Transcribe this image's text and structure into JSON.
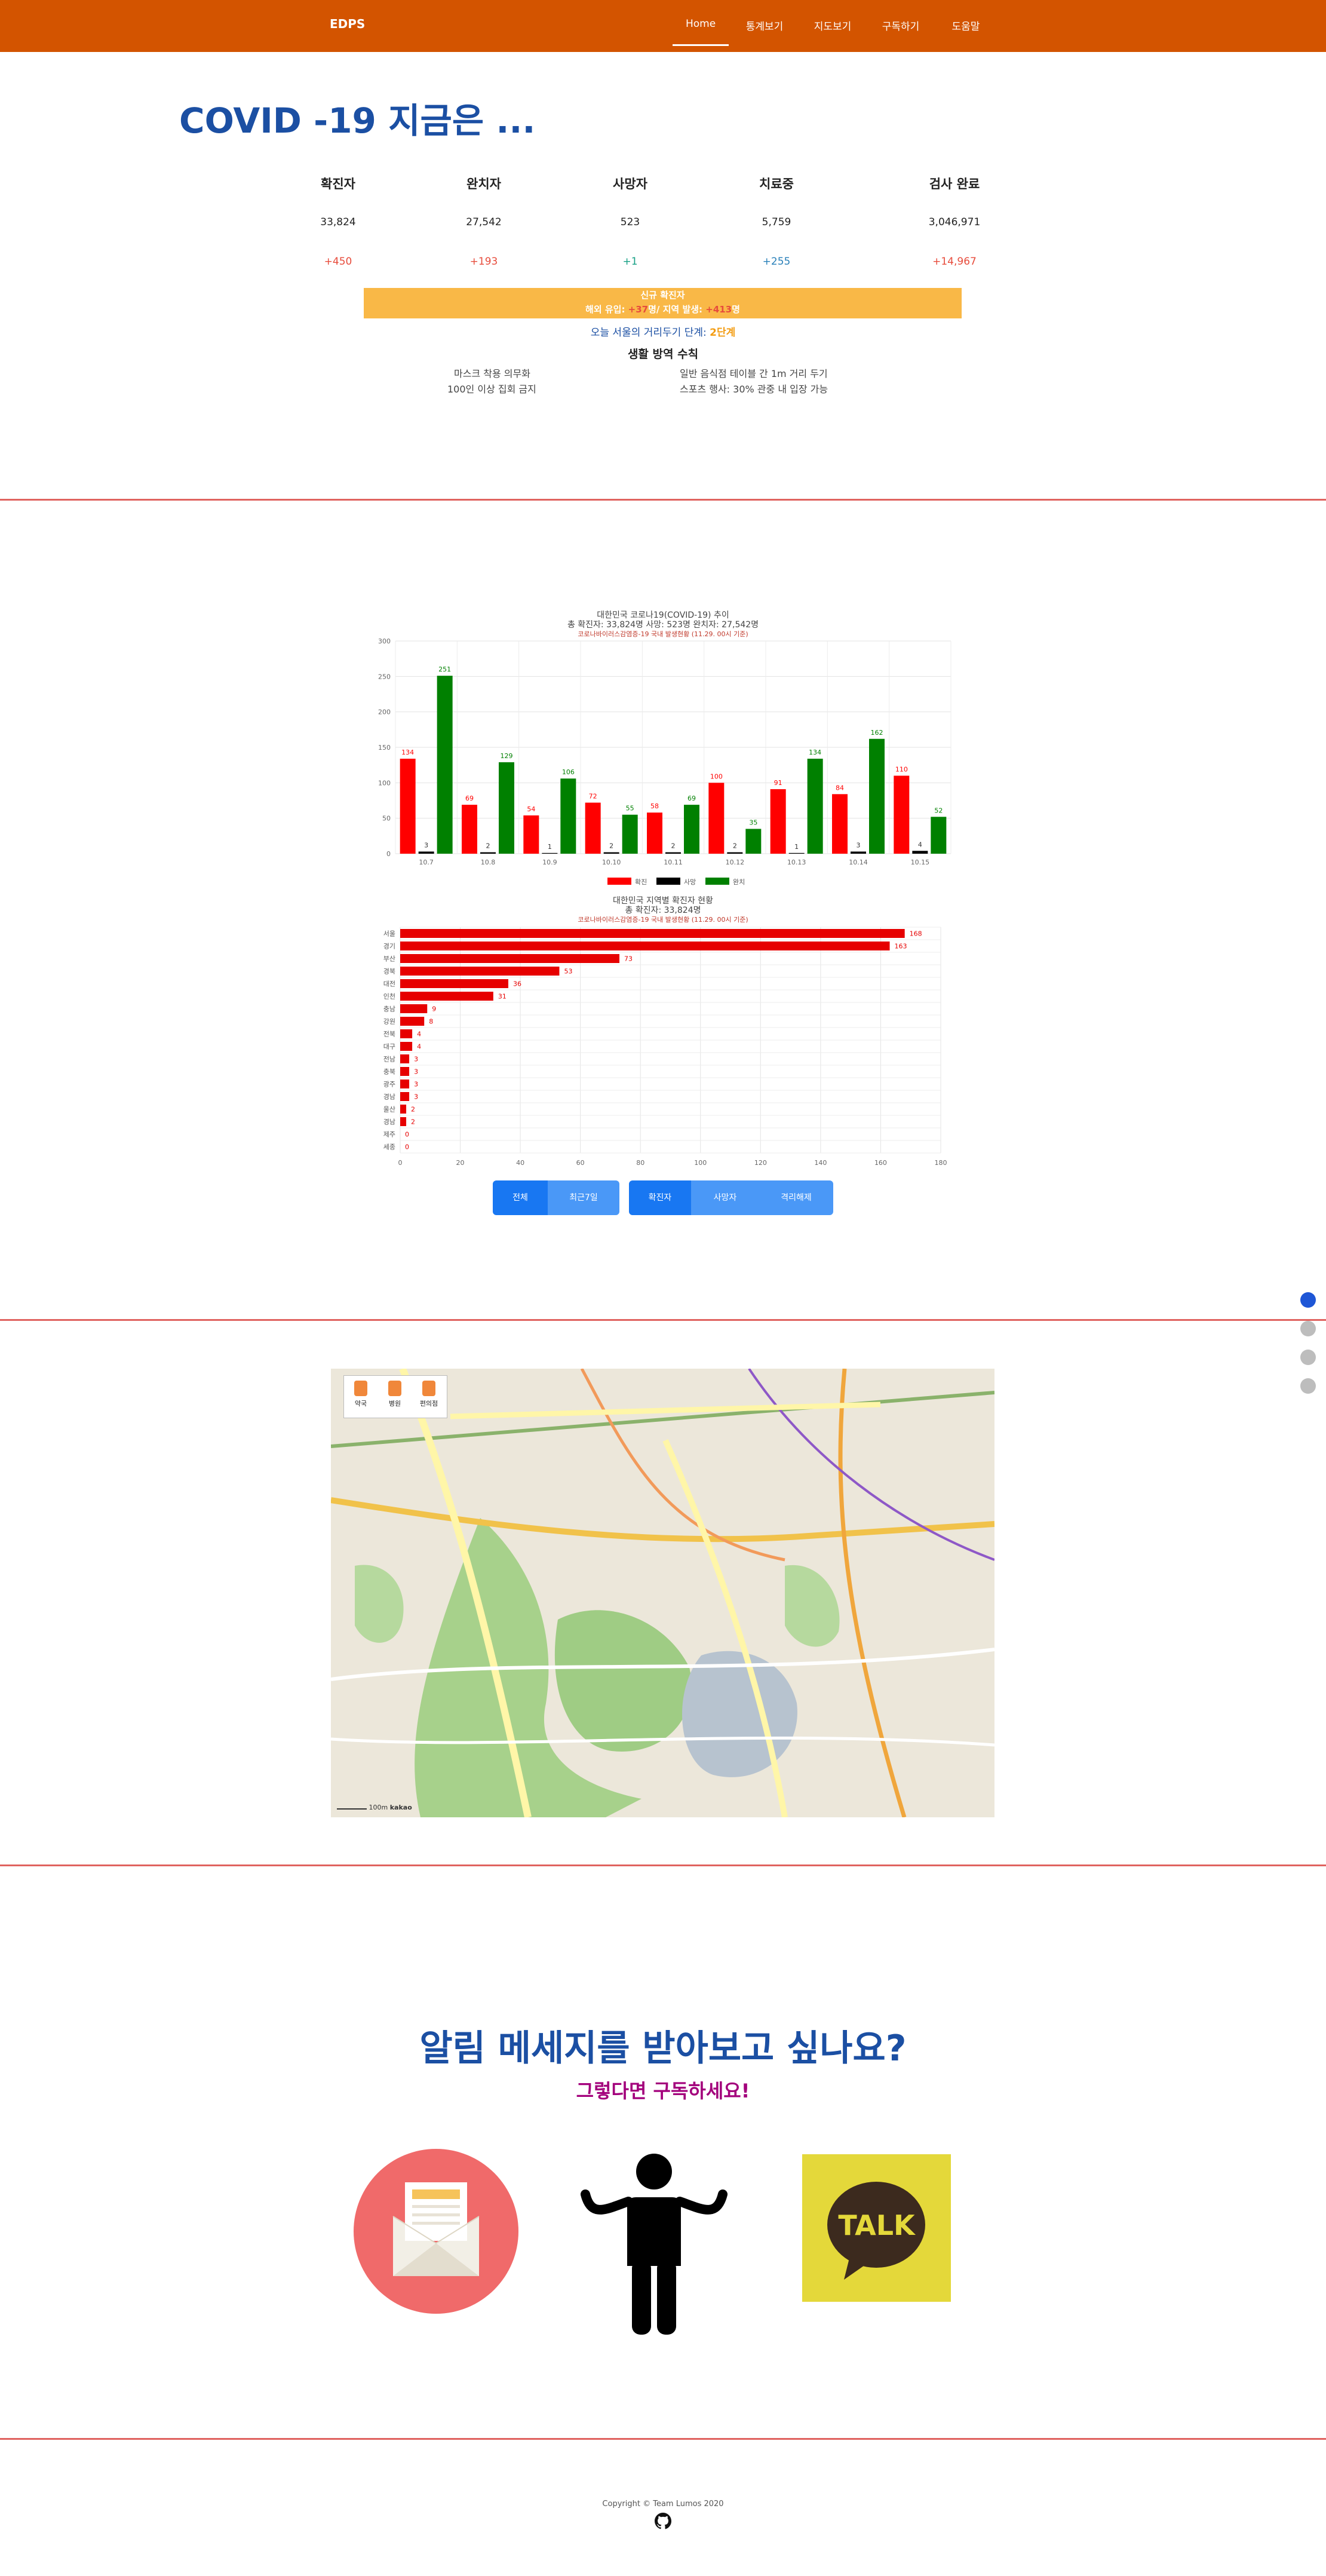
{
  "nav": {
    "brand": "EDPS",
    "items": [
      "Home",
      "통계보기",
      "지도보기",
      "구독하기",
      "도움말"
    ]
  },
  "hero": {
    "title": "COVID -19 지금은 ...",
    "stats": [
      {
        "label": "확진자",
        "value": "33,824",
        "delta": "+450",
        "delta_color": "#e74c3c"
      },
      {
        "label": "완치자",
        "value": "27,542",
        "delta": "+193",
        "delta_color": "#e74c3c"
      },
      {
        "label": "사망자",
        "value": "523",
        "delta": "+1",
        "delta_color": "#16a085"
      },
      {
        "label": "치료중",
        "value": "5,759",
        "delta": "+255",
        "delta_color": "#2980b9"
      },
      {
        "label": "검사 완료",
        "value": "3,046,971",
        "delta": "+14,967",
        "delta_color": "#e74c3c"
      }
    ],
    "alert_title": "신규 확진자",
    "alert_line": {
      "a": "해외 유입: ",
      "b": "+37",
      "c": "명/ 지역 발생: ",
      "d": "+413",
      "e": "명"
    },
    "level_text": "오늘 서울의 거리두기 단계: ",
    "level_value": "2단계",
    "rules_title": "생활 방역 수칙",
    "rules": [
      "마스크 착용 의무화",
      "일반 음식점 테이블 간 1m 거리 두기",
      "100인 이상 집회 금지",
      "스포츠 행사: 30% 관중 내 입장 가능"
    ]
  },
  "chart_data": [
    {
      "type": "bar",
      "title": "대한민국 코로나19(COVID-19) 추이",
      "subtitle": "총 확진자: 33,824명  사망: 523명  완치자: 27,542명",
      "source": "코로나바이러스감염증-19 국내 발생현황 (11.29. 00시 기준)",
      "categories": [
        "10.7",
        "10.8",
        "10.9",
        "10.10",
        "10.11",
        "10.12",
        "10.13",
        "10.14",
        "10.15"
      ],
      "series": [
        {
          "name": "확진",
          "color": "#ff0000",
          "values": [
            134,
            69,
            54,
            72,
            58,
            100,
            91,
            84,
            110
          ]
        },
        {
          "name": "사망",
          "color": "#000000",
          "values": [
            3,
            2,
            1,
            2,
            2,
            2,
            1,
            3,
            4
          ]
        },
        {
          "name": "완치",
          "color": "#008000",
          "values": [
            251,
            129,
            106,
            55,
            69,
            35,
            134,
            162,
            52
          ]
        }
      ],
      "ylim": [
        0,
        300
      ],
      "yticks": [
        0,
        50,
        100,
        150,
        200,
        250,
        300
      ],
      "grid": true,
      "legend": "bottom"
    },
    {
      "type": "bar",
      "orientation": "horizontal",
      "title": "대한민국 지역별 확진자 현황",
      "subtitle": "총 확진자: 33,824명",
      "source": "코로나바이러스감염증-19 국내 발생현황 (11.29. 00시 기준)",
      "categories": [
        "서울",
        "경기",
        "부산",
        "경북",
        "대전",
        "인천",
        "충남",
        "강원",
        "전북",
        "대구",
        "전남",
        "충북",
        "광주",
        "경남",
        "울산",
        "경남",
        "제주",
        "세종"
      ],
      "values": [
        168,
        163,
        73,
        53,
        36,
        31,
        9,
        8,
        4,
        4,
        3,
        3,
        3,
        3,
        2,
        2,
        0,
        0
      ],
      "color": "#e60000",
      "xlim": [
        0,
        180
      ],
      "xticks": [
        0,
        20,
        40,
        60,
        80,
        100,
        120,
        140,
        160,
        180
      ],
      "grid": true
    }
  ],
  "chart_buttons": {
    "left": [
      "전체",
      "최근7일"
    ],
    "right": [
      "확진자",
      "사망자",
      "격리해제"
    ]
  },
  "map": {
    "controls": [
      "약국",
      "병원",
      "편의점"
    ],
    "scale_label": "100m",
    "provider": "kakao"
  },
  "subscribe": {
    "title": "알림 메세지를 받아보고 싶나요?",
    "subtitle": "그렇다면 구독하세요!",
    "kakao_label": "TALK"
  },
  "footer": {
    "copyright": "Copyright © Team Lumos 2020"
  }
}
